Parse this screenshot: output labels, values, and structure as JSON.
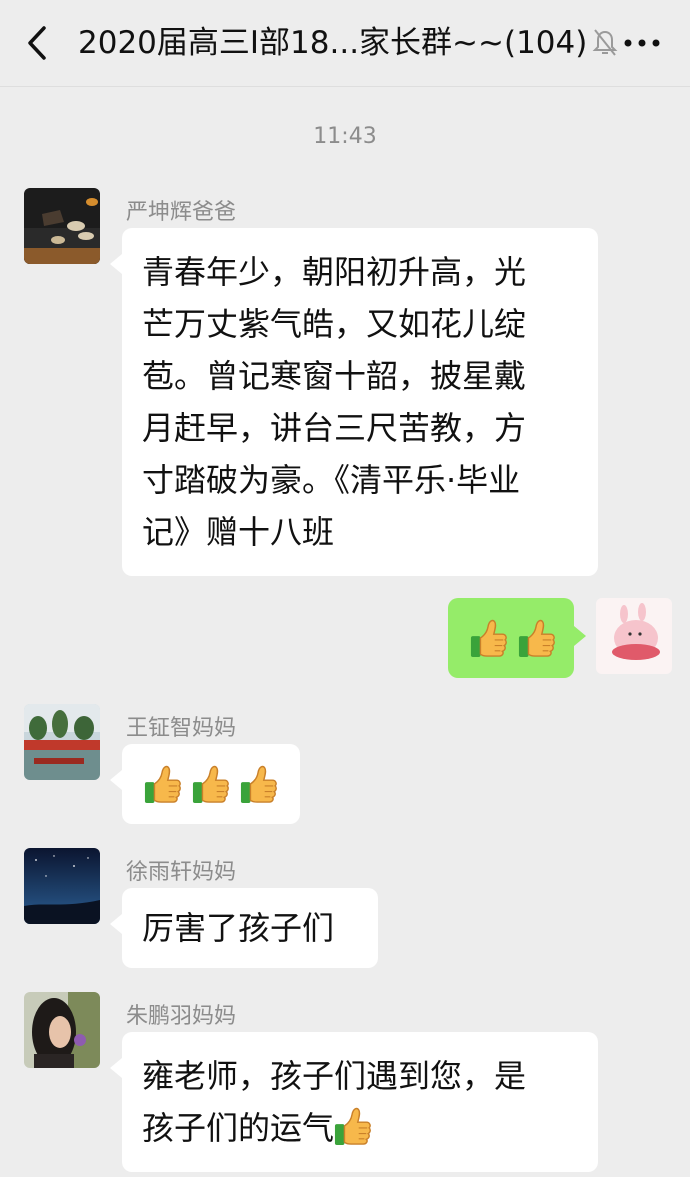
{
  "header": {
    "title": "2020届高三I部18...家长群~~(104)",
    "icons": [
      "back-icon",
      "mute-bell-icon",
      "more-icon"
    ]
  },
  "timestamp": "11:43",
  "messages": [
    {
      "sender": "严坤辉爸爸",
      "lines": [
        "青春年少，朝阳初升高，光",
        "芒万丈紫气皓，又如花儿绽",
        "苞。曾记寒窗十韶，披星戴",
        "月赶早，讲台三尺苦教，方",
        "寸踏破为豪。《清平乐·毕业",
        "记》赠十八班"
      ]
    },
    {
      "sender": "self",
      "emoji": "thumbs-up x2"
    },
    {
      "sender": "王钲智妈妈",
      "emoji": "thumbs-up x3"
    },
    {
      "sender": "徐雨轩妈妈",
      "text": "厉害了孩子们"
    },
    {
      "sender": "朱鹏羽妈妈",
      "lines": [
        "雍老师，孩子们遇到您，是",
        "孩子们的运气"
      ],
      "emoji": "thumbs-up"
    }
  ],
  "colors": {
    "background": "#ededed",
    "own_bubble": "#95ec69",
    "other_bubble": "#ffffff"
  }
}
